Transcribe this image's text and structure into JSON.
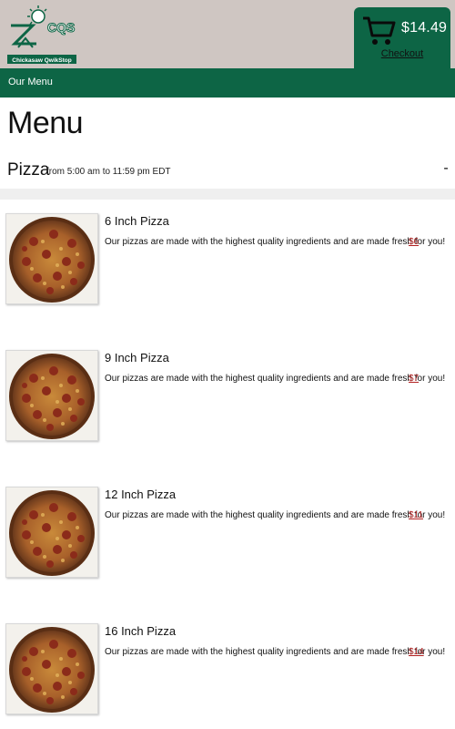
{
  "brand": {
    "logo_letters": "CQS",
    "logo_text": "Chickasaw QwikStop",
    "primary_color": "#0d6545",
    "header_bg": "#cfc6c2"
  },
  "cart": {
    "icon": "shopping-cart-icon",
    "total": "$14.49",
    "checkout_label": "Checkout"
  },
  "nav": {
    "items": [
      {
        "label": "Our Menu"
      }
    ]
  },
  "page": {
    "title": "Menu"
  },
  "section": {
    "name": "Pizza",
    "hours": "from 5:00 am to 11:59 pm EDT",
    "toggle": "-"
  },
  "items": [
    {
      "name": "6 Inch Pizza",
      "description": "Our pizzas are made with the highest quality ingredients and are made fresh for you!",
      "price": "$6"
    },
    {
      "name": "9 Inch Pizza",
      "description": "Our pizzas are made with the highest quality ingredients and are made fresh for you!",
      "price": "$7"
    },
    {
      "name": "12 Inch Pizza",
      "description": "Our pizzas are made with the highest quality ingredients and are made fresh for you!",
      "price": "$11"
    },
    {
      "name": "16 Inch Pizza",
      "description": "Our pizzas are made with the highest quality ingredients and are made fresh for you!",
      "price": "$14"
    }
  ]
}
